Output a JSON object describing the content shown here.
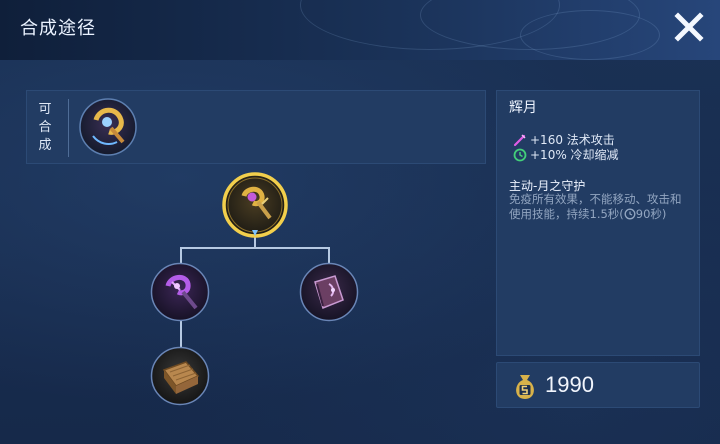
{
  "header": {
    "title": "合成途径"
  },
  "compose": {
    "label": "可合成",
    "items": [
      {
        "icon": "golden-staff-item-icon"
      }
    ]
  },
  "tree": {
    "root": {
      "icon": "moon-glow-staff-icon",
      "selected": true
    },
    "children": [
      {
        "icon": "purple-wand-icon",
        "children": [
          {
            "icon": "wooden-book-icon"
          }
        ]
      },
      {
        "icon": "purple-tome-icon",
        "children": []
      }
    ]
  },
  "item": {
    "name": "辉月",
    "stats": [
      {
        "icon": "magic-attack-icon",
        "text": "+160 法术攻击",
        "color": "#e05ce6"
      },
      {
        "icon": "cooldown-icon",
        "text": "+10% 冷却缩减",
        "color": "#43d07a"
      }
    ],
    "skill_title": "主动-月之守护",
    "skill_desc": "免疫所有效果，不能移动、攻击和使用技能，持续1.5秒",
    "cooldown_open": "(",
    "cooldown": "90秒)"
  },
  "price": {
    "icon": "gold-bag-icon",
    "value": "1990"
  },
  "colors": {
    "accent": "#b6c9e2",
    "panel": "#223c63",
    "gold": "#d8b24a"
  }
}
